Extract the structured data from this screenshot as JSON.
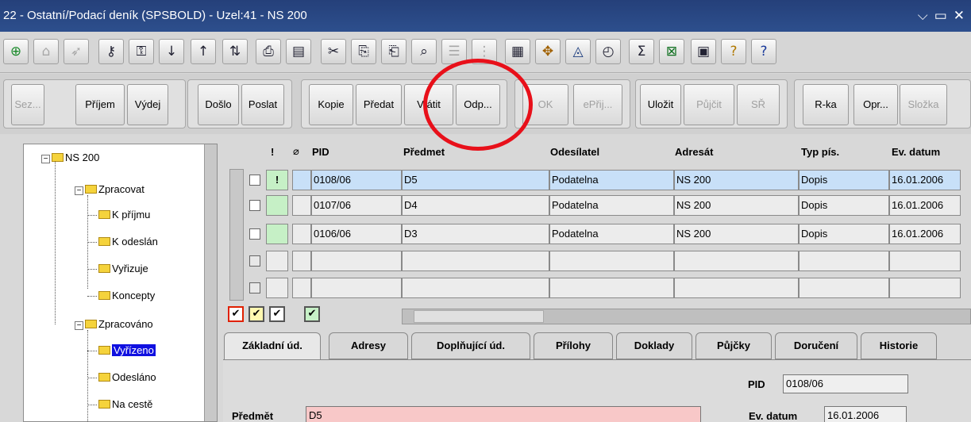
{
  "window": {
    "title": "22 - Ostatní/Podací deník (SPSBOLD) - Uzel:41 - NS 200",
    "controls": [
      "⌵",
      "▭",
      "✕"
    ]
  },
  "toolbar_icons": [
    "green-plus",
    "back",
    "forward",
    "key",
    "key-refresh",
    "sort-asc",
    "sort-desc",
    "filter",
    "print",
    "print-preview",
    "cut",
    "copy",
    "copy-b",
    "search",
    "list",
    "list-b",
    "calc",
    "network",
    "eye",
    "clock",
    "sum",
    "excel",
    "app",
    "help",
    "help-b"
  ],
  "actions": {
    "sez": "Sez...",
    "prijem": "Příjem",
    "vydej": "Výdej",
    "doslo": "Došlo",
    "poslat": "Poslat",
    "kopie": "Kopie",
    "predat": "Předat",
    "vratit": "Vrátit",
    "odp": "Odp...",
    "ok": "OK",
    "eprij": "ePřij...",
    "ulozit": "Uložit",
    "pujcit": "Půjčit",
    "sr": "SŘ",
    "rka": "R-ka",
    "opr": "Opr...",
    "slozka": "Složka"
  },
  "tree": {
    "root": "NS 200",
    "zpracovat": "Zpracovat",
    "k_prijmu": "K příjmu",
    "k_odeslani": "K odeslán",
    "vyrizuje": "Vyřizuje",
    "koncepty": "Koncepty",
    "zpracovano": "Zpracováno",
    "vyrizeno": "Vyřízeno",
    "odeslano": "Odesláno",
    "na_ceste": "Na cestě"
  },
  "grid": {
    "headers": {
      "flag": "!",
      "pid": "PID",
      "predmet": "Předmet",
      "odesilatel": "Odesílatel",
      "adresat": "Adresát",
      "typ": "Typ pís.",
      "ev_datum": "Ev. datum"
    },
    "rows": [
      {
        "flag": "!",
        "pid": "0108/06",
        "predmet": "D5",
        "odesilatel": "Podatelna",
        "adresat": "NS 200",
        "typ": "Dopis",
        "ev_datum": "16.01.2006"
      },
      {
        "flag": "",
        "pid": "0107/06",
        "predmet": "D4",
        "odesilatel": "Podatelna",
        "adresat": "NS 200",
        "typ": "Dopis",
        "ev_datum": "16.01.2006"
      },
      {
        "flag": "",
        "pid": "0106/06",
        "predmet": "D3",
        "odesilatel": "Podatelna",
        "adresat": "NS 200",
        "typ": "Dopis",
        "ev_datum": "16.01.2006"
      }
    ]
  },
  "check_mark": "✔",
  "tabs": [
    "Základní úd.",
    "Adresy",
    "Doplňující úd.",
    "Přílohy",
    "Doklady",
    "Půjčky",
    "Doručení",
    "Historie"
  ],
  "form": {
    "pid_label": "PID",
    "pid_value": "0108/06",
    "predmet_label": "Předmět",
    "predmet_value": "D5",
    "ev_datum_label": "Ev. datum",
    "ev_datum_value": "16.01.2006"
  },
  "colors": {
    "highlight_circle": "#e8101a",
    "selected_tree": "#1010e0",
    "selected_row": "#c8e0f8",
    "predmet_field": "#f8c8c8"
  }
}
